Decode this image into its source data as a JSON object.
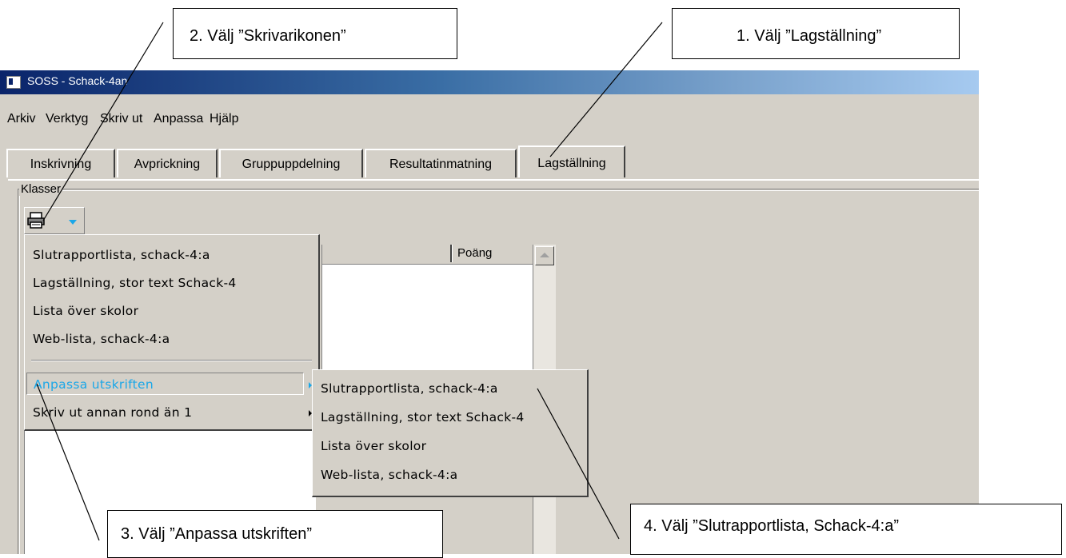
{
  "window": {
    "title": "SOSS - Schack-4an"
  },
  "menubar": [
    "Arkiv",
    "Verktyg",
    "Skriv ut",
    "Anpassa",
    "Hjälp"
  ],
  "tabs": [
    "Inskrivning",
    "Avprickning",
    "Gruppuppdelning",
    "Resultatinmatning",
    "Lagställning"
  ],
  "active_tab": "Lagställning",
  "group_label": "Klasser",
  "grid": {
    "column_header": "Poäng"
  },
  "print_menu": {
    "items": [
      "Slutrapportlista, schack-4:a",
      "Lagställning, stor text Schack-4",
      "Lista över skolor",
      "Web-lista, schack-4:a"
    ],
    "submenus": [
      "Anpassa utskriften",
      "Skriv ut annan rond än 1"
    ],
    "highlighted": "Anpassa utskriften"
  },
  "submenu": {
    "items": [
      "Slutrapportlista, schack-4:a",
      "Lagställning, stor text Schack-4",
      "Lista över skolor",
      "Web-lista, schack-4:a"
    ]
  },
  "callouts": {
    "step1": "1.    Välj ”Lagställning”",
    "step2": "2. Välj ”Skrivarikonen”",
    "step3": "3. Välj ”Anpassa utskriften”",
    "step4": "4. Välj ”Slutrapportlista, Schack-4:a”"
  },
  "colors": {
    "title_gradient_start": "#0a246a",
    "highlight_text": "#1ba7e8",
    "face": "#d4d0c8"
  }
}
